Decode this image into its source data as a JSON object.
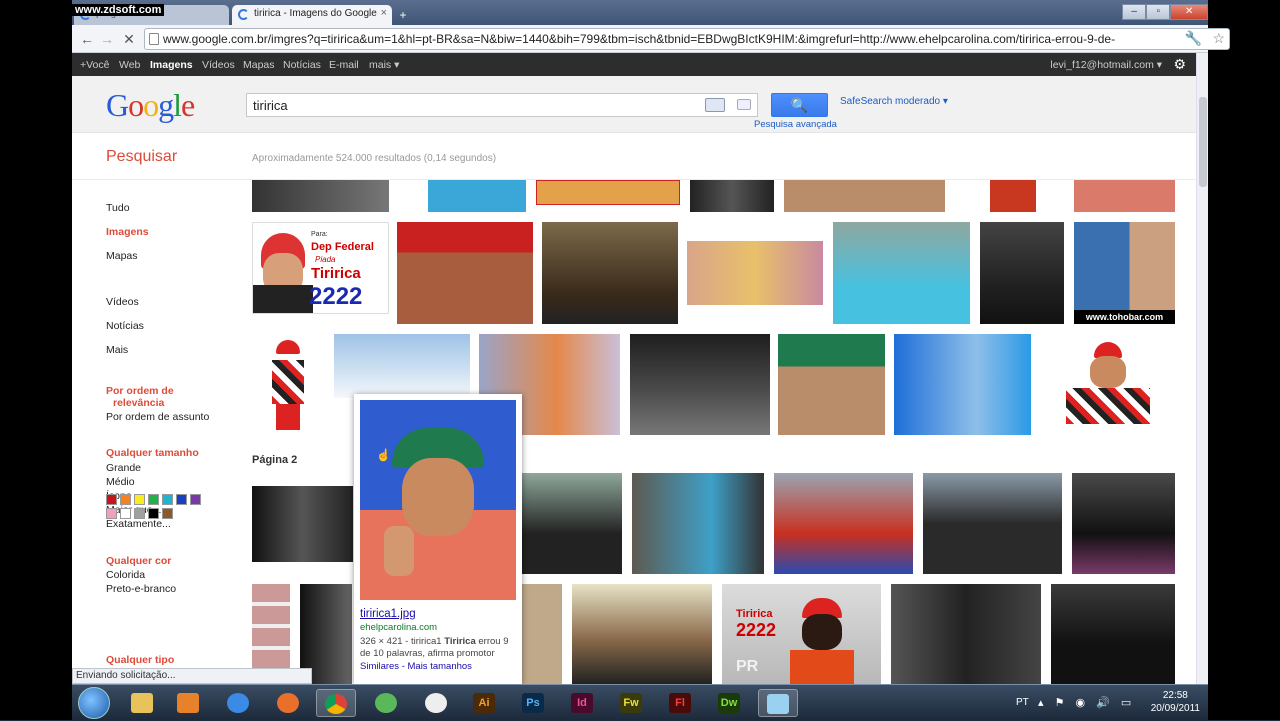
{
  "watermark": "www.zdsoft.com",
  "tabs": [
    {
      "label": "perguntas",
      "active": false
    },
    {
      "label": "tiririca - Imagens do Google",
      "active": true
    }
  ],
  "window_controls": {
    "min": "–",
    "max": "▫",
    "close": "✕"
  },
  "toolbar": {
    "url": "www.google.com.br/imgres?q=tiririca&um=1&hl=pt-BR&sa=N&biw=1440&bih=799&tbm=isch&tbnid=EBDwgBIctK9HIM:&imgrefurl=http://www.ehelpcarolina.com/tiririca-errou-9-de-"
  },
  "gbar": {
    "items": [
      "+Você",
      "Web",
      "Imagens",
      "Vídeos",
      "Mapas",
      "Notícias",
      "E-mail",
      "mais ▾"
    ],
    "active": "Imagens",
    "user": "levi_f12@hotmail.com ▾"
  },
  "header": {
    "logo": [
      "G",
      "o",
      "o",
      "g",
      "l",
      "e"
    ],
    "logo_colors": [
      "#2a5bd7",
      "#d3372b",
      "#f2b20f",
      "#2a5bd7",
      "#1e9a3e",
      "#d3372b"
    ],
    "query": "tiririca",
    "search_button": "🔍",
    "safesearch": "SafeSearch moderado ▾",
    "advanced": "Pesquisa avançada"
  },
  "subhead": {
    "title": "Pesquisar",
    "stats": "Aproximadamente 524.000 resultados (0,14 segundos)"
  },
  "leftnav": {
    "top": [
      "Tudo",
      "Imagens",
      "Mapas"
    ],
    "selected": "Imagens",
    "more": [
      "Vídeos",
      "Notícias",
      "Mais"
    ],
    "order_head_1": "Por ordem de",
    "order_head_2": "relevância",
    "order_alt": "Por ordem de assunto",
    "size_head": "Qualquer tamanho",
    "sizes": [
      "Grande",
      "Médio",
      "Ícone",
      "Maior que...",
      "Exatamente..."
    ],
    "color_head": "Qualquer cor",
    "colors": [
      "Colorida",
      "Preto-e-branco"
    ],
    "swatches": [
      "#c4161c",
      "#f4821f",
      "#f8ed20",
      "#23b14d",
      "#1fb5d0",
      "#1a3fbf",
      "#7b38a8",
      "#f19ec2",
      "#ffffff",
      "#a0a0a0",
      "#000000",
      "#8b5a2b"
    ],
    "type_head": "Qualquer tipo"
  },
  "results": {
    "page_label": "Página 2",
    "text_thumbs": {
      "federal_1": "Para:",
      "federal_2": "Dep Federal",
      "federal_3": "Piada",
      "federal_4": "Tiririca",
      "federal_5": "2222",
      "tohobar": "www.tohobar.com",
      "poster_1": "Tiririca",
      "poster_2": "2222",
      "poster_3": "PR"
    }
  },
  "hover_card": {
    "filename": "tiririca1.jpg",
    "domain": "ehelpcarolina.com",
    "desc_prefix": "326 × 421 - tiririca1 ",
    "desc_bold": "Tiririca",
    "desc_suffix": " errou 9 de 10 palavras, afirma promotor",
    "links": "Similares - Mais tamanhos"
  },
  "status_bar": "Enviando solicitação...",
  "taskbar": {
    "apps": [
      "",
      "",
      "",
      "",
      "",
      "",
      "",
      "",
      "",
      "Ai",
      "Ps",
      "Id",
      "Fw",
      "Fl",
      "Dw",
      ""
    ],
    "lang": "PT",
    "time": "22:58",
    "date": "20/09/2011"
  }
}
